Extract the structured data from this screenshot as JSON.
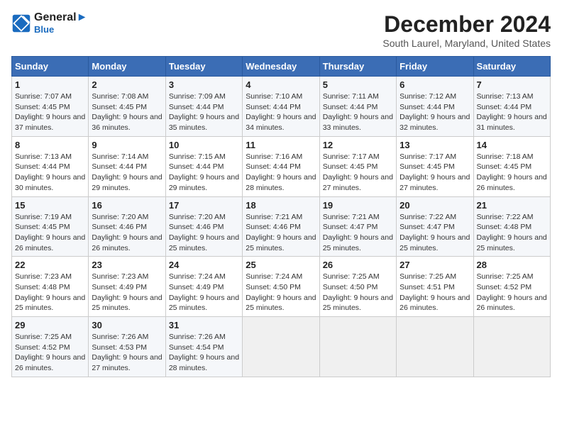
{
  "header": {
    "logo_line1": "General",
    "logo_line2": "Blue",
    "title": "December 2024",
    "subtitle": "South Laurel, Maryland, United States"
  },
  "columns": [
    "Sunday",
    "Monday",
    "Tuesday",
    "Wednesday",
    "Thursday",
    "Friday",
    "Saturday"
  ],
  "weeks": [
    [
      {
        "day": "1",
        "sunrise": "Sunrise: 7:07 AM",
        "sunset": "Sunset: 4:45 PM",
        "daylight": "Daylight: 9 hours and 37 minutes."
      },
      {
        "day": "2",
        "sunrise": "Sunrise: 7:08 AM",
        "sunset": "Sunset: 4:45 PM",
        "daylight": "Daylight: 9 hours and 36 minutes."
      },
      {
        "day": "3",
        "sunrise": "Sunrise: 7:09 AM",
        "sunset": "Sunset: 4:44 PM",
        "daylight": "Daylight: 9 hours and 35 minutes."
      },
      {
        "day": "4",
        "sunrise": "Sunrise: 7:10 AM",
        "sunset": "Sunset: 4:44 PM",
        "daylight": "Daylight: 9 hours and 34 minutes."
      },
      {
        "day": "5",
        "sunrise": "Sunrise: 7:11 AM",
        "sunset": "Sunset: 4:44 PM",
        "daylight": "Daylight: 9 hours and 33 minutes."
      },
      {
        "day": "6",
        "sunrise": "Sunrise: 7:12 AM",
        "sunset": "Sunset: 4:44 PM",
        "daylight": "Daylight: 9 hours and 32 minutes."
      },
      {
        "day": "7",
        "sunrise": "Sunrise: 7:13 AM",
        "sunset": "Sunset: 4:44 PM",
        "daylight": "Daylight: 9 hours and 31 minutes."
      }
    ],
    [
      {
        "day": "8",
        "sunrise": "Sunrise: 7:13 AM",
        "sunset": "Sunset: 4:44 PM",
        "daylight": "Daylight: 9 hours and 30 minutes."
      },
      {
        "day": "9",
        "sunrise": "Sunrise: 7:14 AM",
        "sunset": "Sunset: 4:44 PM",
        "daylight": "Daylight: 9 hours and 29 minutes."
      },
      {
        "day": "10",
        "sunrise": "Sunrise: 7:15 AM",
        "sunset": "Sunset: 4:44 PM",
        "daylight": "Daylight: 9 hours and 29 minutes."
      },
      {
        "day": "11",
        "sunrise": "Sunrise: 7:16 AM",
        "sunset": "Sunset: 4:44 PM",
        "daylight": "Daylight: 9 hours and 28 minutes."
      },
      {
        "day": "12",
        "sunrise": "Sunrise: 7:17 AM",
        "sunset": "Sunset: 4:45 PM",
        "daylight": "Daylight: 9 hours and 27 minutes."
      },
      {
        "day": "13",
        "sunrise": "Sunrise: 7:17 AM",
        "sunset": "Sunset: 4:45 PM",
        "daylight": "Daylight: 9 hours and 27 minutes."
      },
      {
        "day": "14",
        "sunrise": "Sunrise: 7:18 AM",
        "sunset": "Sunset: 4:45 PM",
        "daylight": "Daylight: 9 hours and 26 minutes."
      }
    ],
    [
      {
        "day": "15",
        "sunrise": "Sunrise: 7:19 AM",
        "sunset": "Sunset: 4:45 PM",
        "daylight": "Daylight: 9 hours and 26 minutes."
      },
      {
        "day": "16",
        "sunrise": "Sunrise: 7:20 AM",
        "sunset": "Sunset: 4:46 PM",
        "daylight": "Daylight: 9 hours and 26 minutes."
      },
      {
        "day": "17",
        "sunrise": "Sunrise: 7:20 AM",
        "sunset": "Sunset: 4:46 PM",
        "daylight": "Daylight: 9 hours and 25 minutes."
      },
      {
        "day": "18",
        "sunrise": "Sunrise: 7:21 AM",
        "sunset": "Sunset: 4:46 PM",
        "daylight": "Daylight: 9 hours and 25 minutes."
      },
      {
        "day": "19",
        "sunrise": "Sunrise: 7:21 AM",
        "sunset": "Sunset: 4:47 PM",
        "daylight": "Daylight: 9 hours and 25 minutes."
      },
      {
        "day": "20",
        "sunrise": "Sunrise: 7:22 AM",
        "sunset": "Sunset: 4:47 PM",
        "daylight": "Daylight: 9 hours and 25 minutes."
      },
      {
        "day": "21",
        "sunrise": "Sunrise: 7:22 AM",
        "sunset": "Sunset: 4:48 PM",
        "daylight": "Daylight: 9 hours and 25 minutes."
      }
    ],
    [
      {
        "day": "22",
        "sunrise": "Sunrise: 7:23 AM",
        "sunset": "Sunset: 4:48 PM",
        "daylight": "Daylight: 9 hours and 25 minutes."
      },
      {
        "day": "23",
        "sunrise": "Sunrise: 7:23 AM",
        "sunset": "Sunset: 4:49 PM",
        "daylight": "Daylight: 9 hours and 25 minutes."
      },
      {
        "day": "24",
        "sunrise": "Sunrise: 7:24 AM",
        "sunset": "Sunset: 4:49 PM",
        "daylight": "Daylight: 9 hours and 25 minutes."
      },
      {
        "day": "25",
        "sunrise": "Sunrise: 7:24 AM",
        "sunset": "Sunset: 4:50 PM",
        "daylight": "Daylight: 9 hours and 25 minutes."
      },
      {
        "day": "26",
        "sunrise": "Sunrise: 7:25 AM",
        "sunset": "Sunset: 4:50 PM",
        "daylight": "Daylight: 9 hours and 25 minutes."
      },
      {
        "day": "27",
        "sunrise": "Sunrise: 7:25 AM",
        "sunset": "Sunset: 4:51 PM",
        "daylight": "Daylight: 9 hours and 26 minutes."
      },
      {
        "day": "28",
        "sunrise": "Sunrise: 7:25 AM",
        "sunset": "Sunset: 4:52 PM",
        "daylight": "Daylight: 9 hours and 26 minutes."
      }
    ],
    [
      {
        "day": "29",
        "sunrise": "Sunrise: 7:25 AM",
        "sunset": "Sunset: 4:52 PM",
        "daylight": "Daylight: 9 hours and 26 minutes."
      },
      {
        "day": "30",
        "sunrise": "Sunrise: 7:26 AM",
        "sunset": "Sunset: 4:53 PM",
        "daylight": "Daylight: 9 hours and 27 minutes."
      },
      {
        "day": "31",
        "sunrise": "Sunrise: 7:26 AM",
        "sunset": "Sunset: 4:54 PM",
        "daylight": "Daylight: 9 hours and 28 minutes."
      },
      null,
      null,
      null,
      null
    ]
  ]
}
